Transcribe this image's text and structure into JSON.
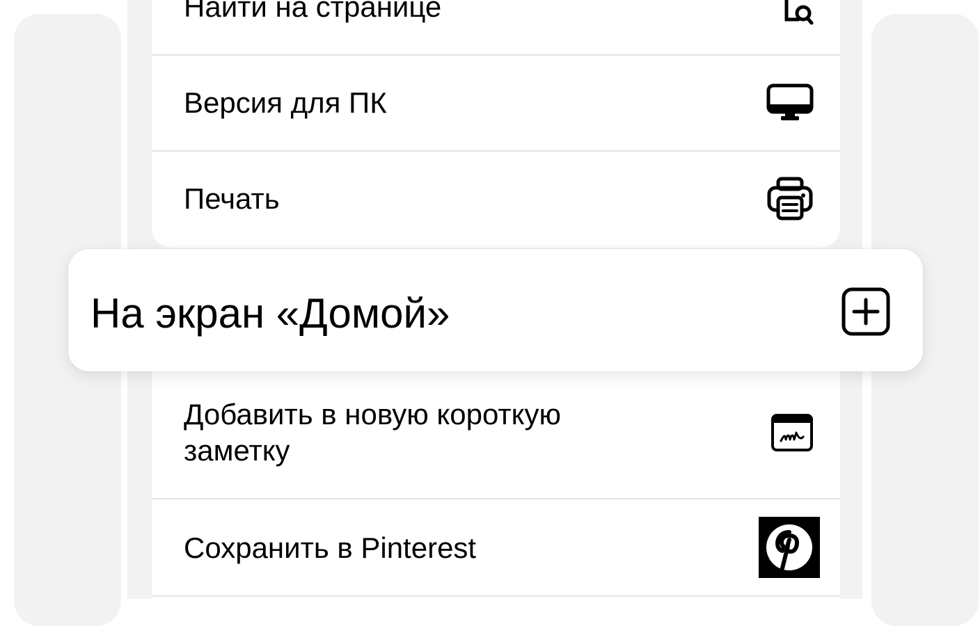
{
  "background_color": "#f2f2f2",
  "menu": {
    "items": [
      {
        "label": "Найти на странице",
        "icon": "find-on-page-icon"
      },
      {
        "label": "Версия для ПК",
        "icon": "desktop-icon"
      },
      {
        "label": "Печать",
        "icon": "printer-icon"
      }
    ],
    "lifted_item": {
      "label": "На экран «Домой»",
      "icon": "add-square-icon"
    },
    "items_below": [
      {
        "label_line1": "Добавить в новую короткую",
        "label_line2": "заметку",
        "icon": "quick-note-icon"
      },
      {
        "label": "Сохранить в Pinterest",
        "icon": "pinterest-icon"
      }
    ]
  }
}
